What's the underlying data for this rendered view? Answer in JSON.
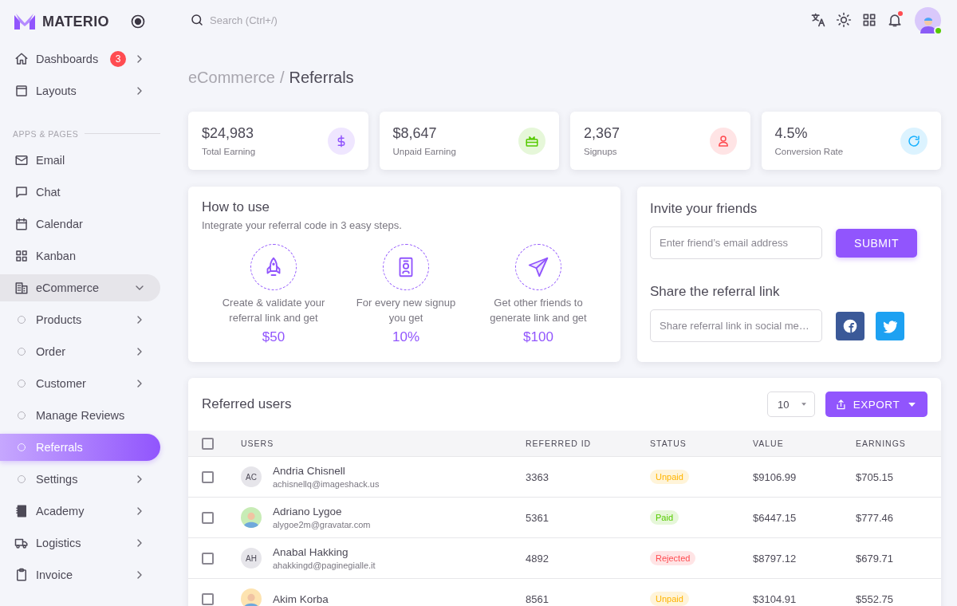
{
  "brand": {
    "name": "MATERIO"
  },
  "sidebar": {
    "items": [
      {
        "kind": "link",
        "label": "Dashboards",
        "badge": "3",
        "expandable": true,
        "selected": false
      },
      {
        "kind": "link",
        "label": "Layouts",
        "expandable": true,
        "selected": false
      },
      {
        "kind": "section",
        "label": "APPS & PAGES"
      },
      {
        "kind": "link",
        "label": "Email",
        "expandable": false,
        "selected": false
      },
      {
        "kind": "link",
        "label": "Chat",
        "expandable": false,
        "selected": false
      },
      {
        "kind": "link",
        "label": "Calendar",
        "expandable": false,
        "selected": false
      },
      {
        "kind": "link",
        "label": "Kanban",
        "expandable": false,
        "selected": false
      },
      {
        "kind": "link",
        "label": "eCommerce",
        "expandable": true,
        "expanded": true,
        "selected": false,
        "children": [
          {
            "label": "Products",
            "expandable": true,
            "selected": false
          },
          {
            "label": "Order",
            "expandable": true,
            "selected": false
          },
          {
            "label": "Customer",
            "expandable": true,
            "selected": false
          },
          {
            "label": "Manage Reviews",
            "expandable": false,
            "selected": false
          },
          {
            "label": "Referrals",
            "expandable": false,
            "selected": true
          },
          {
            "label": "Settings",
            "expandable": true,
            "selected": false
          }
        ]
      },
      {
        "kind": "link",
        "label": "Academy",
        "expandable": true,
        "selected": false
      },
      {
        "kind": "link",
        "label": "Logistics",
        "expandable": true,
        "selected": false
      },
      {
        "kind": "link",
        "label": "Invoice",
        "expandable": true,
        "selected": false
      }
    ]
  },
  "header": {
    "search": {
      "placeholder": "Search (Ctrl+/)"
    },
    "notifications": {
      "unread": true
    },
    "user": {
      "online": true
    }
  },
  "breadcrumb": {
    "parent": "eCommerce",
    "separator": "/",
    "current": "Referrals"
  },
  "stats": [
    {
      "value": "$24,983",
      "label": "Total Earning",
      "color": "#9155fd"
    },
    {
      "value": "$8,647",
      "label": "Unpaid Earning",
      "color": "#56ca00"
    },
    {
      "value": "2,367",
      "label": "Signups",
      "color": "#ff4c51"
    },
    {
      "value": "4.5%",
      "label": "Conversion Rate",
      "color": "#16b1ff"
    }
  ],
  "how_to_use": {
    "title": "How to use",
    "subtitle": "Integrate your referral code in 3 easy steps.",
    "steps": [
      {
        "text": "Create & validate your referral link and get",
        "amount": "$50"
      },
      {
        "text": "For every new signup you get",
        "amount": "10%"
      },
      {
        "text": "Get other friends to generate link and get",
        "amount": "$100"
      }
    ]
  },
  "invite": {
    "title": "Invite your friends",
    "email_field": {
      "placeholder": "Enter friend’s email address"
    },
    "submit": "SUBMIT",
    "share_title": "Share the referral link",
    "share_field": {
      "placeholder": "Share referral link in social me…"
    }
  },
  "referred_users": {
    "title": "Referred users",
    "page_size": "10",
    "export": "EXPORT",
    "all_checked": false,
    "columns": [
      "USERS",
      "REFERRED ID",
      "STATUS",
      "VALUE",
      "EARNINGS"
    ],
    "rows": [
      {
        "checked": false,
        "avatar": {
          "kind": "initials",
          "initials": "AC"
        },
        "name": "Andria Chisnell",
        "email": "achisnellq@imageshack.us",
        "referred_id": "3363",
        "status": {
          "label": "Unpaid",
          "color": "#ffb400"
        },
        "value": "$9106.99",
        "earnings": "$705.15"
      },
      {
        "checked": false,
        "name": "Adriano Lygoe",
        "email": "alygoe2m@gravatar.com",
        "referred_id": "5361",
        "status": {
          "label": "Paid",
          "color": "#56ca00"
        },
        "value": "$6447.15",
        "earnings": "$777.46"
      },
      {
        "checked": false,
        "avatar": {
          "kind": "initials",
          "initials": "AH"
        },
        "name": "Anabal Hakking",
        "email": "ahakkingd@paginegialle.it",
        "referred_id": "4892",
        "status": {
          "label": "Rejected",
          "color": "#ff4c51"
        },
        "value": "$8797.12",
        "earnings": "$679.71"
      },
      {
        "checked": false,
        "name": "Akim Korba",
        "referred_id": "8561",
        "status": {
          "label": "Unpaid",
          "color": "#ffb400"
        },
        "value": "$3104.91",
        "earnings": "$552.75"
      }
    ]
  }
}
